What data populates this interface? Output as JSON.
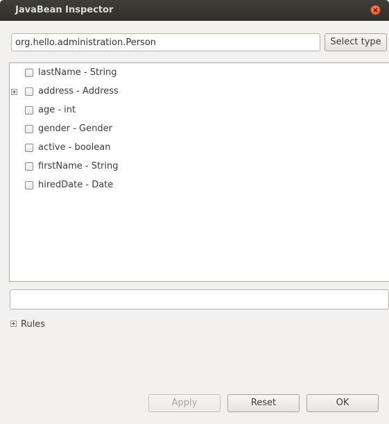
{
  "window": {
    "title": "JavaBean Inspector",
    "close_icon": "close-icon"
  },
  "type_selector": {
    "value": "org.hello.administration.Person",
    "select_label": "Select type"
  },
  "properties": [
    {
      "label": "lastName - String",
      "expandable": false,
      "checked": false
    },
    {
      "label": "address - Address",
      "expandable": true,
      "checked": false
    },
    {
      "label": "age - int",
      "expandable": false,
      "checked": false
    },
    {
      "label": "gender - Gender",
      "expandable": false,
      "checked": false
    },
    {
      "label": "active - boolean",
      "expandable": false,
      "checked": false
    },
    {
      "label": "firstName - String",
      "expandable": false,
      "checked": false
    },
    {
      "label": "hiredDate - Date",
      "expandable": false,
      "checked": false
    }
  ],
  "message": "",
  "rules": {
    "label": "Rules",
    "expanded": false
  },
  "actions": {
    "apply_label": "Apply",
    "apply_enabled": false,
    "reset_label": "Reset",
    "ok_label": "OK"
  },
  "colors": {
    "titlebar": "#3a3935",
    "close_button": "#e95420",
    "background": "#f2f1f0"
  }
}
